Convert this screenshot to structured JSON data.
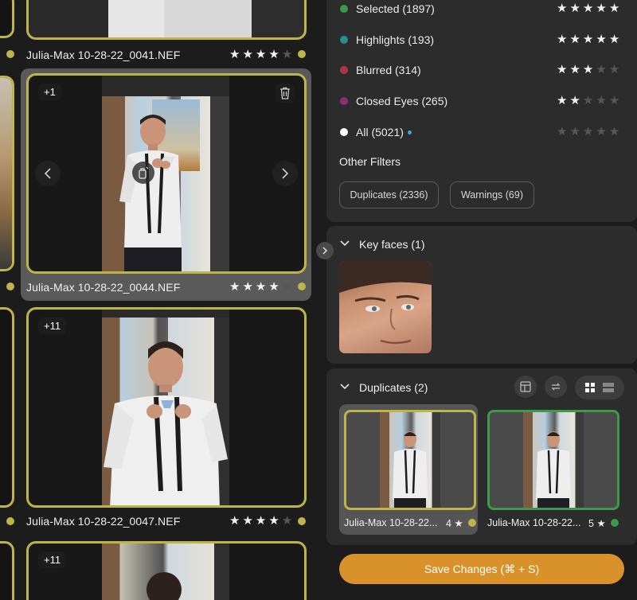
{
  "grid": {
    "items": [
      {
        "filename": "Julia-Max 10-28-22_0041.NEF",
        "rating": 4,
        "badge": ""
      },
      {
        "filename": "Julia-Max 10-28-22_0044.NEF",
        "rating": 4,
        "badge": "+1"
      },
      {
        "filename": "Julia-Max 10-28-22_0047.NEF",
        "rating": 4,
        "badge": "+11"
      },
      {
        "filename": "",
        "rating": 0,
        "badge": "+11"
      }
    ]
  },
  "filters": {
    "rows": [
      {
        "label": "Selected (1897)",
        "color": "#3c9a4a",
        "rating": 5
      },
      {
        "label": "Highlights (193)",
        "color": "#2a8f8f",
        "rating": 5
      },
      {
        "label": "Blurred (314)",
        "color": "#b0343f",
        "rating": 3
      },
      {
        "label": "Closed Eyes (265)",
        "color": "#8a2e78",
        "rating": 2
      },
      {
        "label": "All (5021)",
        "color": "#ffffff",
        "rating": 0
      }
    ],
    "other_title": "Other Filters",
    "pills": [
      "Duplicates (2336)",
      "Warnings (69)"
    ]
  },
  "key_faces": {
    "title": "Key faces (1)"
  },
  "duplicates": {
    "title": "Duplicates (2)",
    "items": [
      {
        "filename": "Julia-Max 10-28-22...",
        "rating": "4",
        "status_color": "#bdb44a"
      },
      {
        "filename": "Julia-Max 10-28-22...",
        "rating": "5",
        "status_color": "#3c9a4a"
      }
    ]
  },
  "save": {
    "label": "Save Changes (⌘ + S)"
  },
  "colors": {
    "accent": "#d9922a",
    "selected_border": "#bdb44a",
    "keep_border": "#3c9a4a",
    "panel": "#2c2c2c"
  }
}
